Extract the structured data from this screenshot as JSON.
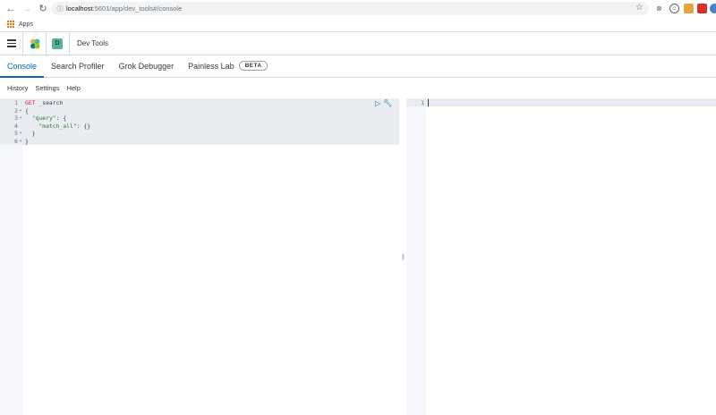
{
  "browser": {
    "url_host": "localhost",
    "url_path": ":5601/app/dev_tools#/console",
    "bookmarks_apps_label": "Apps"
  },
  "header": {
    "space_initial": "D",
    "breadcrumb": "Dev Tools"
  },
  "tabs": [
    {
      "label": "Console",
      "active": true
    },
    {
      "label": "Search Profiler",
      "active": false
    },
    {
      "label": "Grok Debugger",
      "active": false
    },
    {
      "label": "Painless Lab",
      "active": false,
      "badge": "BETA"
    }
  ],
  "submenu": {
    "history": "History",
    "settings": "Settings",
    "help": "Help"
  },
  "editor": {
    "lines": [
      {
        "num": "1",
        "fold": "",
        "method": "GET",
        "text": " _search"
      },
      {
        "num": "2",
        "fold": "▾",
        "text": "{"
      },
      {
        "num": "3",
        "fold": "▾",
        "key": "\"query\"",
        "text": ": {",
        "indent": "  "
      },
      {
        "num": "4",
        "fold": "",
        "key": "\"match_all\"",
        "text": ": {}",
        "indent": "    "
      },
      {
        "num": "5",
        "fold": "▾",
        "text": "  }"
      },
      {
        "num": "6",
        "fold": "▾",
        "text": "}"
      }
    ]
  },
  "output": {
    "line_number": "1"
  },
  "colors": {
    "accent": "#006bb4",
    "method": "#c7254e",
    "json_key": "#2c7a30",
    "active_block": "#e9edf2"
  }
}
